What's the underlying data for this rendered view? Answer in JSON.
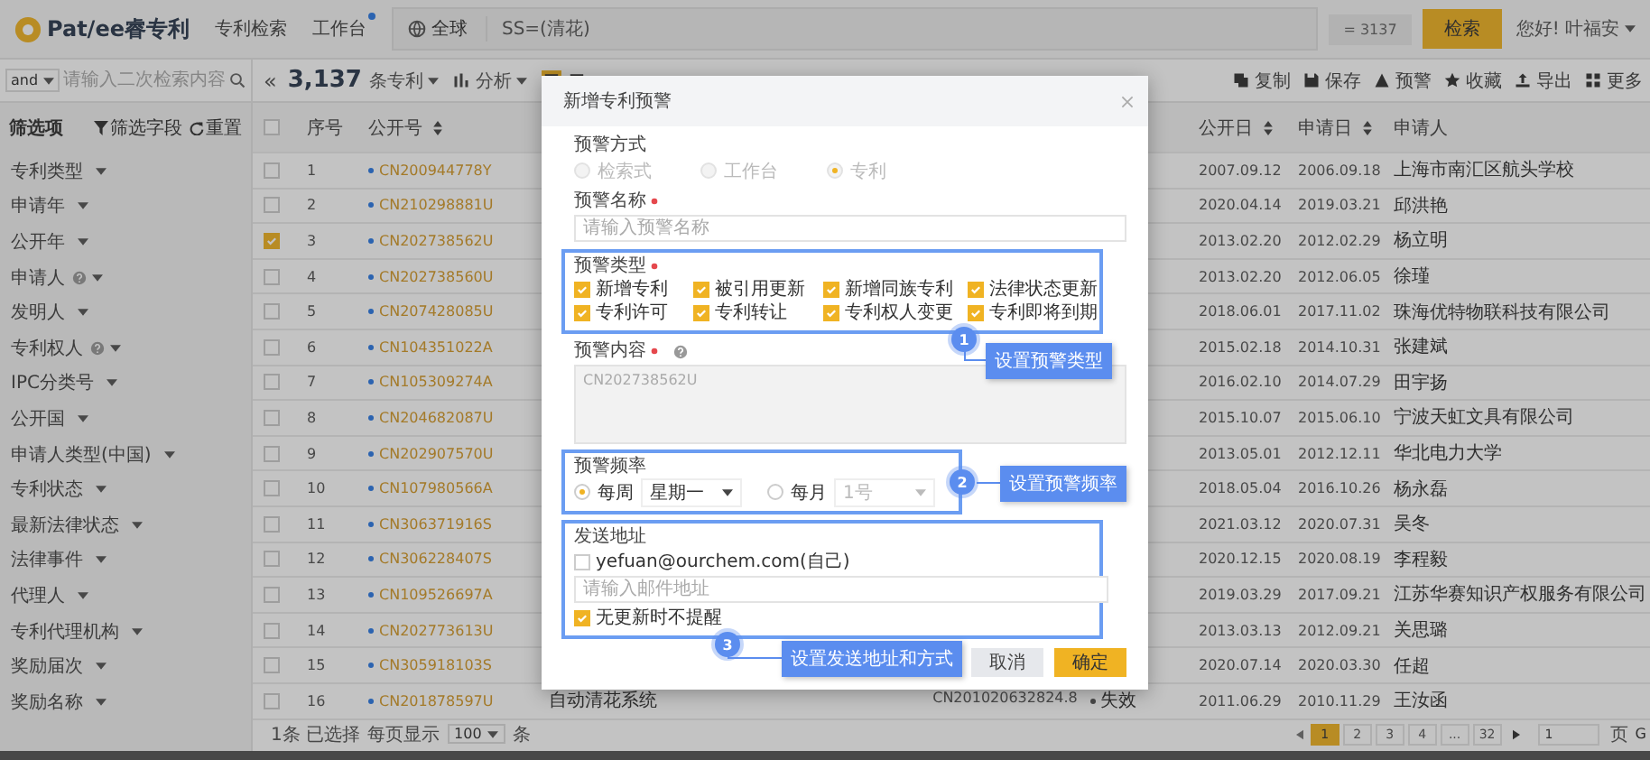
{
  "header": {
    "logo": "Pat/ee睿专利",
    "nav": [
      {
        "label": "专利检索",
        "badge": false
      },
      {
        "label": "工作台",
        "badge": true
      }
    ],
    "scope": "全球",
    "query": "SS=(清花)",
    "count": "= 3137",
    "search_button": "检索",
    "greeting": "您好! 叶福安"
  },
  "toolbar": {
    "operator": "and",
    "search_placeholder": "请输入二次检索内容",
    "collapse": "«",
    "total": "3,137",
    "total_unit": "条专利",
    "analysis": "分析",
    "view_modes": [
      {
        "selected": true
      },
      {
        "selected": false
      }
    ],
    "actions": [
      "复制",
      "保存",
      "预警",
      "收藏",
      "导出",
      "更多"
    ]
  },
  "sidebar": {
    "title": "筛选项",
    "filter_fields": "筛选字段",
    "reset": "重置",
    "items": [
      {
        "label": "专利类型",
        "help": false
      },
      {
        "label": "申请年",
        "help": false
      },
      {
        "label": "公开年",
        "help": false
      },
      {
        "label": "申请人",
        "help": true
      },
      {
        "label": "发明人",
        "help": false
      },
      {
        "label": "专利权人",
        "help": true
      },
      {
        "label": "IPC分类号",
        "help": false
      },
      {
        "label": "公开国",
        "help": false
      },
      {
        "label": "申请人类型(中国)",
        "help": false
      },
      {
        "label": "专利状态",
        "help": false
      },
      {
        "label": "最新法律状态",
        "help": false
      },
      {
        "label": "法律事件",
        "help": false
      },
      {
        "label": "代理人",
        "help": false
      },
      {
        "label": "专利代理机构",
        "help": false
      },
      {
        "label": "奖励届次",
        "help": false
      },
      {
        "label": "奖励名称",
        "help": false
      }
    ]
  },
  "table": {
    "all_selected": false,
    "columns": [
      {
        "label": "序号",
        "sortable": false
      },
      {
        "label": "公开号",
        "sortable": true
      },
      {
        "label": "公开日",
        "sortable": true
      },
      {
        "label": "申请日",
        "sortable": true
      },
      {
        "label": "申请人",
        "sortable": false
      }
    ],
    "rows": [
      {
        "selected": false,
        "no": "1",
        "pub_no": "CN200944778Y",
        "pub_date": "2007.09.12",
        "app_date": "2006.09.18",
        "applicant": "上海市南汇区航头学校"
      },
      {
        "selected": false,
        "no": "2",
        "pub_no": "CN210298881U",
        "pub_date": "2020.04.14",
        "app_date": "2019.03.21",
        "applicant": "邱洪艳"
      },
      {
        "selected": true,
        "no": "3",
        "pub_no": "CN202738562U",
        "pub_date": "2013.02.20",
        "app_date": "2012.02.29",
        "applicant": "杨立明"
      },
      {
        "selected": false,
        "no": "4",
        "pub_no": "CN202738560U",
        "pub_date": "2013.02.20",
        "app_date": "2012.06.05",
        "applicant": "徐瑾"
      },
      {
        "selected": false,
        "no": "5",
        "pub_no": "CN207428085U",
        "pub_date": "2018.06.01",
        "app_date": "2017.11.02",
        "applicant": "珠海优特物联科技有限公司"
      },
      {
        "selected": false,
        "no": "6",
        "pub_no": "CN104351022A",
        "pub_date": "2015.02.18",
        "app_date": "2014.10.31",
        "applicant": "张建斌"
      },
      {
        "selected": false,
        "no": "7",
        "pub_no": "CN105309274A",
        "pub_date": "2016.02.10",
        "app_date": "2014.07.29",
        "applicant": "田宇扬"
      },
      {
        "selected": false,
        "no": "8",
        "pub_no": "CN204682087U",
        "pub_date": "2015.10.07",
        "app_date": "2015.06.10",
        "applicant": "宁波天虹文具有限公司"
      },
      {
        "selected": false,
        "no": "9",
        "pub_no": "CN202907570U",
        "pub_date": "2013.05.01",
        "app_date": "2012.12.11",
        "applicant": "华北电力大学"
      },
      {
        "selected": false,
        "no": "10",
        "pub_no": "CN107980566A",
        "pub_date": "2018.05.04",
        "app_date": "2016.10.26",
        "applicant": "杨永磊"
      },
      {
        "selected": false,
        "no": "11",
        "pub_no": "CN306371916S",
        "pub_date": "2021.03.12",
        "app_date": "2020.07.31",
        "applicant": "吴冬"
      },
      {
        "selected": false,
        "no": "12",
        "pub_no": "CN306228407S",
        "pub_date": "2020.12.15",
        "app_date": "2020.08.19",
        "applicant": "李程毅"
      },
      {
        "selected": false,
        "no": "13",
        "pub_no": "CN109526697A",
        "pub_date": "2019.03.29",
        "app_date": "2017.09.21",
        "applicant": "江苏华赛知识产权服务有限公司"
      },
      {
        "selected": false,
        "no": "14",
        "pub_no": "CN202773613U",
        "pub_date": "2013.03.13",
        "app_date": "2012.09.21",
        "applicant": "关思璐"
      },
      {
        "selected": false,
        "no": "15",
        "pub_no": "CN305918103S",
        "pub_date": "2020.07.14",
        "app_date": "2020.03.30",
        "applicant": "任超"
      },
      {
        "selected": false,
        "no": "16",
        "pub_no": "CN201878597U",
        "title": "自动清花系统",
        "app_no": "CN201020632824.8",
        "status": "失效",
        "pub_date": "2011.06.29",
        "app_date": "2010.11.29",
        "applicant": "王汝函"
      }
    ]
  },
  "footer": {
    "selected_count": "1条 已选择",
    "page_size_label": "每页显示",
    "page_size": "100",
    "page_size_unit": "条",
    "pages": [
      {
        "label": "1",
        "selected": true
      },
      {
        "label": "2",
        "selected": false
      },
      {
        "label": "3",
        "selected": false
      },
      {
        "label": "4",
        "selected": false
      },
      {
        "label": "...",
        "selected": false
      },
      {
        "label": "32",
        "selected": false
      }
    ],
    "goto_value": "1",
    "goto_unit": "页",
    "go": "G"
  },
  "modal": {
    "title": "新增专利预警",
    "alert_method": {
      "label": "预警方式",
      "disabled": true,
      "options": [
        {
          "label": "检索式",
          "selected": false
        },
        {
          "label": "工作台",
          "selected": false
        },
        {
          "label": "专利",
          "selected": true
        }
      ]
    },
    "alert_name": {
      "label": "预警名称",
      "required": true,
      "placeholder": "请输入预警名称"
    },
    "alert_types": {
      "label": "预警类型",
      "required": true,
      "options": [
        {
          "label": "新增专利",
          "checked": true
        },
        {
          "label": "被引用更新",
          "checked": true
        },
        {
          "label": "新增同族专利",
          "checked": true
        },
        {
          "label": "法律状态更新",
          "checked": true
        },
        {
          "label": "专利许可",
          "checked": true
        },
        {
          "label": "专利转让",
          "checked": true
        },
        {
          "label": "专利权人变更",
          "checked": true
        },
        {
          "label": "专利即将到期",
          "checked": true
        }
      ],
      "annotation": {
        "number": "1",
        "label": "设置预警类型"
      }
    },
    "alert_content": {
      "label": "预警内容",
      "required": true,
      "help": true,
      "value": "CN202738562U",
      "disabled": true
    },
    "frequency": {
      "label": "预警频率",
      "options": [
        {
          "label": "每周",
          "selected": true,
          "select": "星期一"
        },
        {
          "label": "每月",
          "selected": false,
          "select": "1号"
        }
      ],
      "annotation": {
        "number": "2",
        "label": "设置预警频率"
      }
    },
    "send_address": {
      "label": "发送地址",
      "self_email": {
        "label": "yefuan@ourchem.com(自己)",
        "checked": false
      },
      "email_placeholder": "请输入邮件地址",
      "no_update_silent": {
        "label": "无更新时不提醒",
        "checked": true
      },
      "annotation": {
        "number": "3",
        "label": "设置发送地址和方式"
      }
    },
    "buttons": {
      "cancel": "取消",
      "ok": "确定"
    }
  }
}
